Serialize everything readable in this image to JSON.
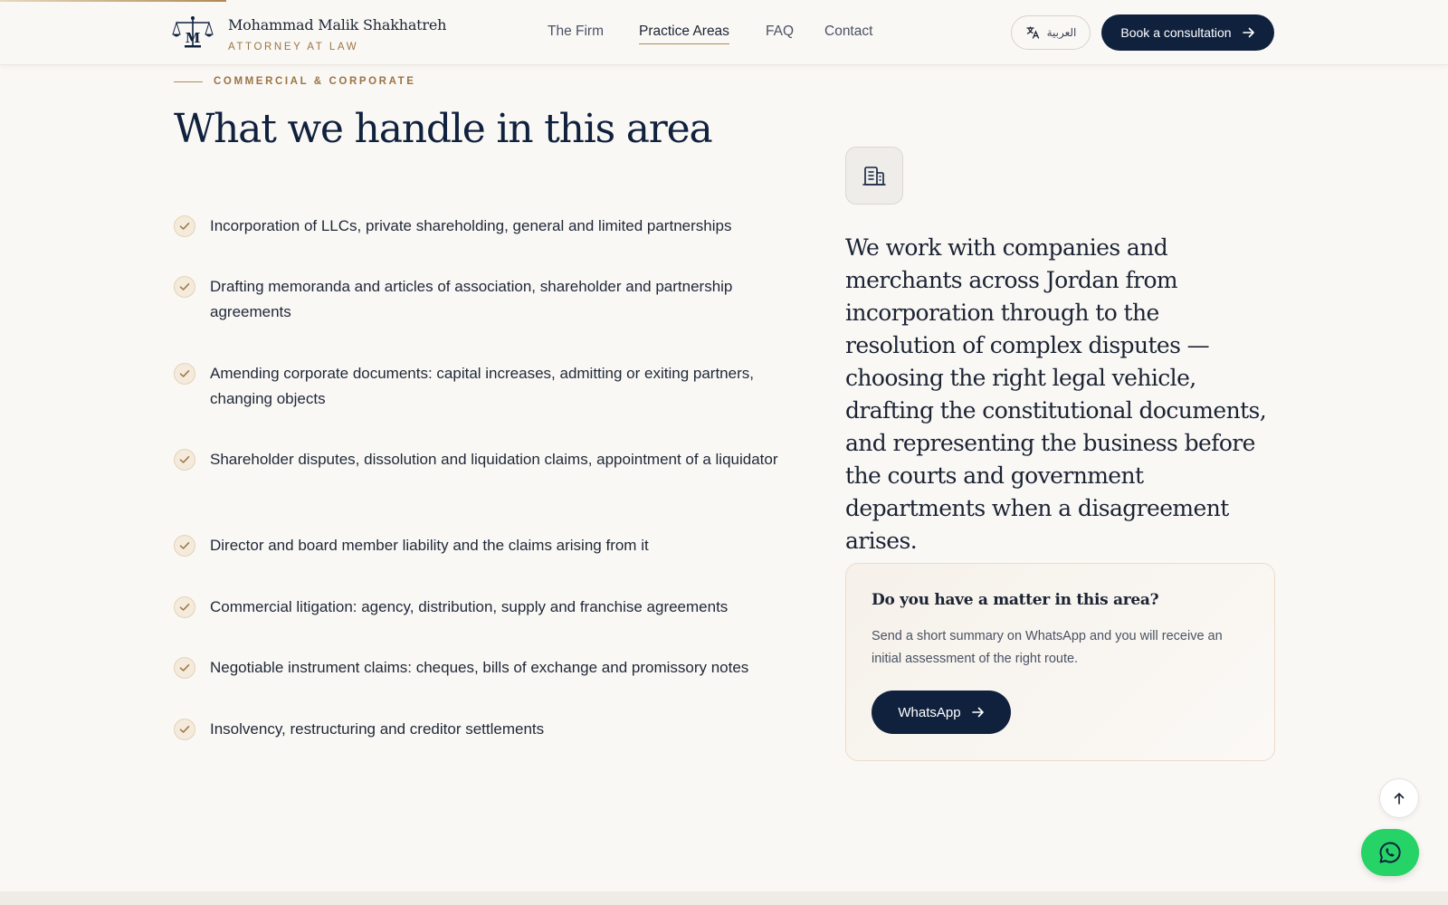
{
  "header": {
    "brand_name": "Mohammad Malik Shakhatreh",
    "brand_subtitle": "ATTORNEY AT LAW",
    "nav": [
      {
        "label": "The Firm",
        "active": false
      },
      {
        "label": "Practice Areas",
        "active": true
      },
      {
        "label": "FAQ",
        "active": false
      },
      {
        "label": "Contact",
        "active": false
      }
    ],
    "language_label": "العربية",
    "language_icon": "translate-icon",
    "book_label": "Book a consultation",
    "book_icon": "arrow-right-icon"
  },
  "section": {
    "eyebrow": "COMMERCIAL & CORPORATE",
    "title": "What we handle in this area",
    "items": [
      "Incorporation of LLCs, private shareholding, general and limited partnerships",
      "Drafting memoranda and articles of association, shareholder and partnership agreements",
      "Amending corporate documents: capital increases, admitting or exiting partners, changing objects",
      "Shareholder disputes, dissolution and liquidation claims, appointment of a liquidator",
      "Director and board member liability and the claims arising from it",
      "Commercial litigation: agency, distribution, supply and franchise agreements",
      "Negotiable instrument claims: cheques, bills of exchange and promissory notes",
      "Insolvency, restructuring and creditor settlements"
    ]
  },
  "aside": {
    "icon": "building-icon",
    "intro": "We work with companies and merchants across Jordan from incorporation through to the resolution of complex disputes — choosing the right legal vehicle, drafting the constitutional documents, and representing the business before the courts and government departments when a disagreement arises.",
    "cta_title": "Do you have a matter in this area?",
    "cta_body": "Send a short summary on WhatsApp and you will receive an initial assessment of the right route.",
    "cta_button": "WhatsApp"
  },
  "floating": {
    "scroll_top_icon": "arrow-up-icon",
    "whatsapp_icon": "whatsapp-icon"
  },
  "colors": {
    "navy": "#10213e",
    "gold": "#b08a54",
    "background": "#faf8f5",
    "whatsapp_green": "#25d366"
  }
}
